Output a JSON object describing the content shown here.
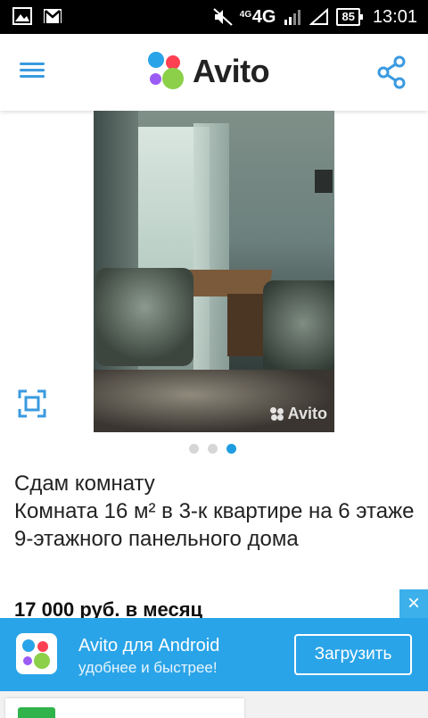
{
  "status_bar": {
    "network_badge": "4G",
    "network": "4G",
    "battery": "85",
    "time": "13:01"
  },
  "header": {
    "logo_text": "Avito"
  },
  "gallery": {
    "watermark": "Avito",
    "page_count": 3,
    "current_page": 3
  },
  "listing": {
    "title_line1": "Сдам комнату",
    "title_line2": "Комната 16 м² в 3-к квартире на 6 этаже 9-этажного панельного дома",
    "price": "17 000 руб. в месяц"
  },
  "banner": {
    "close_symbol": "×",
    "title": "Avito для Android",
    "subtitle": "удобнее и быстрее!",
    "button_label": "Загрузить"
  },
  "colors": {
    "accent": "#2aa4e8",
    "dot_active": "#1e9ce0",
    "logo_blue": "#2aa4e8",
    "logo_red": "#ff4053",
    "logo_purple": "#9b5cf5",
    "logo_green": "#8cd04a"
  }
}
